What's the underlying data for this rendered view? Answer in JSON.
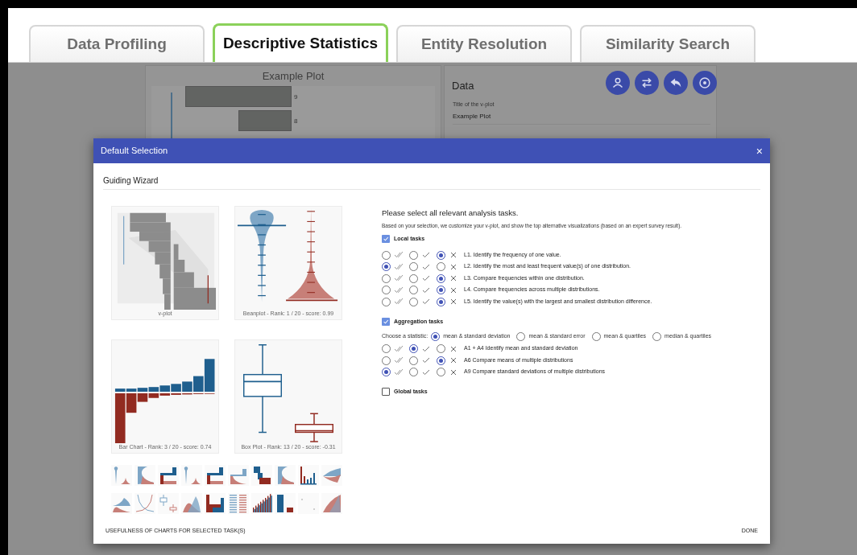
{
  "tabs": [
    {
      "label": "Data Profiling",
      "selected": false
    },
    {
      "label": "Descriptive Statistics",
      "selected": true
    },
    {
      "label": "Entity Resolution",
      "selected": false
    },
    {
      "label": "Similarity Search",
      "selected": false
    }
  ],
  "background": {
    "plot": {
      "title": "Example Plot",
      "bar_labels": [
        "9",
        "8"
      ]
    },
    "data_panel": {
      "title": "Data",
      "field_label": "Title of the v-plot",
      "field_value": "Example Plot"
    }
  },
  "dialog": {
    "title": "Default Selection",
    "close": "×",
    "subtitle": "Guiding Wizard",
    "featured": [
      {
        "kind": "vplot",
        "caption": "v-plot"
      },
      {
        "kind": "beanplot",
        "caption": "Beanplot - Rank: 1 / 20 - score: 0.99"
      },
      {
        "kind": "barchart",
        "caption": "Bar Chart - Rank: 3 / 20 - score: 0.74"
      },
      {
        "kind": "boxplot",
        "caption": "Box Plot - Rank: 13 / 20 - score: -0.31"
      }
    ],
    "thumbnails": [
      {
        "kind": "bean"
      },
      {
        "kind": "halfviolin"
      },
      {
        "kind": "mirrorbars"
      },
      {
        "kind": "bean"
      },
      {
        "kind": "mirrorbars"
      },
      {
        "kind": "lightbars"
      },
      {
        "kind": "stairs"
      },
      {
        "kind": "halfviolin"
      },
      {
        "kind": "groupedbars"
      },
      {
        "kind": "diverge"
      },
      {
        "kind": "density"
      },
      {
        "kind": "curves"
      },
      {
        "kind": "miniboxes"
      },
      {
        "kind": "overlap"
      },
      {
        "kind": "ubars"
      },
      {
        "kind": "stripes"
      },
      {
        "kind": "cumulative"
      },
      {
        "kind": "twobars"
      },
      {
        "kind": "dots"
      },
      {
        "kind": "overlap2"
      }
    ],
    "prompt": "Please select all relevant analysis tasks.",
    "description": "Based on your selection, we customize your v-plot, and show the top alternative visualizations (based on an expert survey result).",
    "sections": [
      {
        "label": "Local tasks",
        "checked": true,
        "tasks": [
          {
            "label": "L1. Identify the frequency of one value.",
            "ratings": [
              {
                "selected": false
              },
              {
                "selected": false
              },
              {
                "selected": true
              }
            ]
          },
          {
            "label": "L2. Identify the most and least frequent value(s) of one distribution.",
            "ratings": [
              {
                "selected": true
              },
              {
                "selected": false
              },
              {
                "selected": false
              }
            ]
          },
          {
            "label": "L3. Compare frequencies within one distribution.",
            "ratings": [
              {
                "selected": false
              },
              {
                "selected": false
              },
              {
                "selected": true
              }
            ]
          },
          {
            "label": "L4. Compare frequencies across multiple distributions.",
            "ratings": [
              {
                "selected": false
              },
              {
                "selected": false
              },
              {
                "selected": true
              }
            ]
          },
          {
            "label": "L5. Identify the value(s) with the largest and smallest distribution difference.",
            "ratings": [
              {
                "selected": false
              },
              {
                "selected": false
              },
              {
                "selected": true
              }
            ]
          }
        ]
      },
      {
        "label": "Aggregation tasks",
        "checked": true,
        "statistic": {
          "label": "Choose a statistic:",
          "options": [
            {
              "label": "mean & standard deviation",
              "selected": true
            },
            {
              "label": "mean & standard error",
              "selected": false
            },
            {
              "label": "mean & quartiles",
              "selected": false
            },
            {
              "label": "median & quartiles",
              "selected": false
            }
          ]
        },
        "tasks": [
          {
            "label": "A1 + A4 Identify mean and standard deviation",
            "ratings": [
              {
                "selected": false
              },
              {
                "selected": true
              },
              {
                "selected": false
              }
            ]
          },
          {
            "label": "A6 Compare means of multiple distributions",
            "ratings": [
              {
                "selected": false
              },
              {
                "selected": false
              },
              {
                "selected": true
              }
            ]
          },
          {
            "label": "A9 Compare standard deviations of multiple distributions",
            "ratings": [
              {
                "selected": true
              },
              {
                "selected": false
              },
              {
                "selected": false
              }
            ]
          }
        ]
      },
      {
        "label": "Global tasks",
        "checked": false
      }
    ],
    "footer": {
      "left": "USEFULNESS OF CHARTS FOR SELECTED TASK(S)",
      "right": "DONE"
    }
  }
}
